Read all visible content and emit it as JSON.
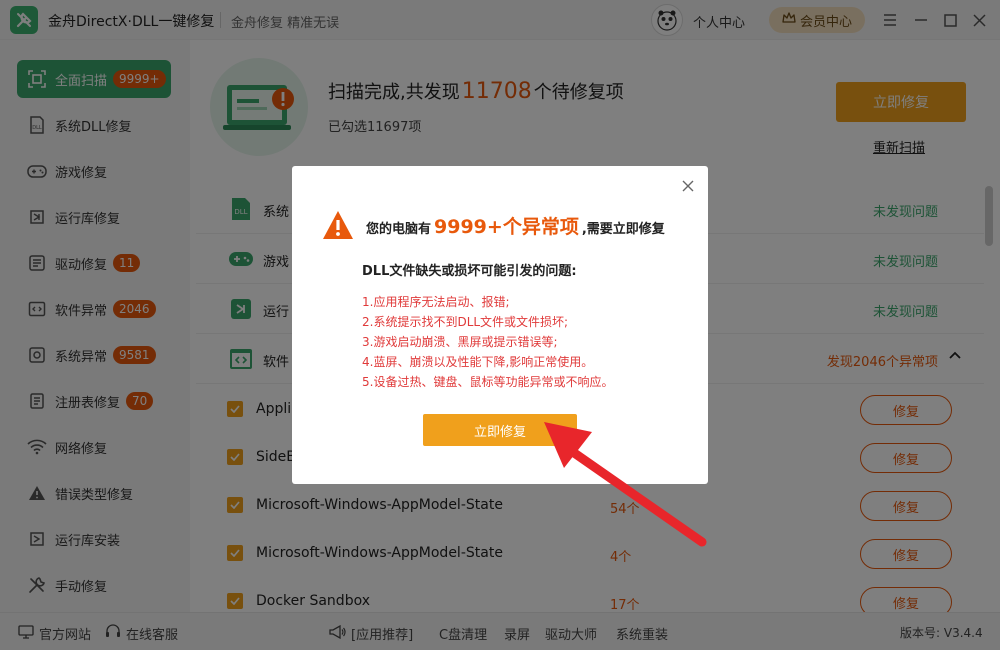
{
  "titlebar": {
    "app_title": "金舟DirectX·DLL一键修复",
    "slogan": "金舟修复 精准无误",
    "user_center": "个人中心",
    "vip_center": "会员中心"
  },
  "sidebar": {
    "items": [
      {
        "label": "全面扫描",
        "badge": "9999+",
        "icon": "scan-icon",
        "active": true
      },
      {
        "label": "系统DLL修复",
        "badge": "",
        "icon": "dll-icon"
      },
      {
        "label": "游戏修复",
        "badge": "",
        "icon": "gamepad-icon"
      },
      {
        "label": "运行库修复",
        "badge": "",
        "icon": "runtime-icon"
      },
      {
        "label": "驱动修复",
        "badge": "11",
        "icon": "driver-icon"
      },
      {
        "label": "软件异常",
        "badge": "2046",
        "icon": "code-icon"
      },
      {
        "label": "系统异常",
        "badge": "9581",
        "icon": "gear-icon"
      },
      {
        "label": "注册表修复",
        "badge": "70",
        "icon": "registry-icon"
      },
      {
        "label": "网络修复",
        "badge": "",
        "icon": "wifi-icon"
      },
      {
        "label": "错误类型修复",
        "badge": "",
        "icon": "warning-icon"
      },
      {
        "label": "运行库安装",
        "badge": "",
        "icon": "install-icon"
      },
      {
        "label": "手动修复",
        "badge": "",
        "icon": "wrench-icon"
      }
    ]
  },
  "header": {
    "scan_prefix": "扫描完成,共发现",
    "scan_count": "11708",
    "scan_suffix": "个待修复项",
    "selected": "已勾选11697项",
    "fix_now": "立即修复",
    "rescan": "重新扫描"
  },
  "list": {
    "categories": [
      {
        "name": "系统",
        "status": "未发现问题",
        "icon": "dll-icon"
      },
      {
        "name": "游戏",
        "status": "未发现问题",
        "icon": "gamepad-icon"
      },
      {
        "name": "运行",
        "status": "未发现问题",
        "icon": "runtime-icon"
      },
      {
        "name": "软件",
        "status": "发现2046个异常项",
        "icon": "code-icon"
      }
    ],
    "items": [
      {
        "name": "Appli",
        "count": "",
        "fix": "修复"
      },
      {
        "name": "SideB",
        "count": "",
        "fix": "修复"
      },
      {
        "name": "Microsoft-Windows-AppModel-State",
        "count": "54个",
        "fix": "修复"
      },
      {
        "name": "Microsoft-Windows-AppModel-State",
        "count": "4个",
        "fix": "修复"
      },
      {
        "name": "Docker Sandbox",
        "count": "17个",
        "fix": "修复"
      }
    ]
  },
  "dialog": {
    "head_prefix": "您的电脑有",
    "head_count": "9999+个异常项",
    "head_suffix": ",需要立即修复",
    "sub": "DLL文件缺失或损坏可能引发的问题:",
    "problems": [
      "1.应用程序无法启动、报错;",
      "2.系统提示找不到DLL文件或文件损坏;",
      "3.游戏启动崩溃、黑屏或提示错误等;",
      "4.蓝屏、崩溃以及性能下降,影响正常使用。",
      "5.设备过热、键盘、鼠标等功能异常或不响应。"
    ],
    "fix_button": "立即修复"
  },
  "bottombar": {
    "official": "官方网站",
    "service": "在线客服",
    "recommend": "[应用推荐]",
    "links": [
      "C盘清理",
      "录屏",
      "驱动大师",
      "系统重装"
    ],
    "version": "版本号: V3.4.4"
  },
  "colors": {
    "accent_green": "#3aa76d",
    "accent_orange": "#f0a01c",
    "alert_red": "#e8590c"
  }
}
